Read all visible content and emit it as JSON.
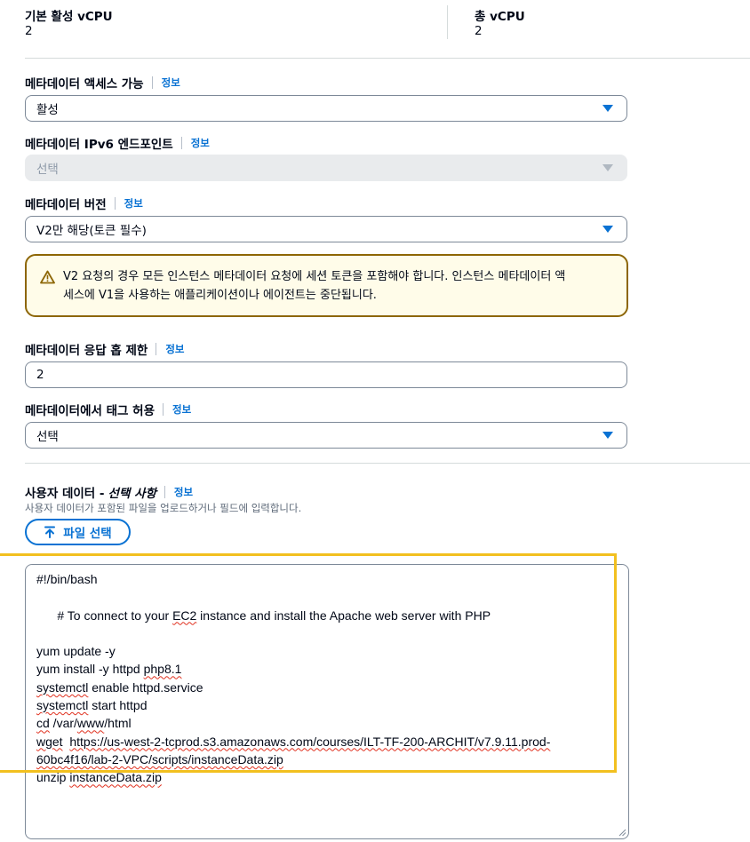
{
  "stats": {
    "default_vcpu_label": "기본 활성 vCPU",
    "default_vcpu_value": "2",
    "total_vcpu_label": "총 vCPU",
    "total_vcpu_value": "2"
  },
  "metadata_access": {
    "label": "메타데이터 액세스 가능",
    "info": "정보",
    "value": "활성"
  },
  "metadata_ipv6": {
    "label": "메타데이터 IPv6 엔드포인트",
    "info": "정보",
    "value": "선택"
  },
  "metadata_version": {
    "label": "메타데이터 버전",
    "info": "정보",
    "value": "V2만 해당(토큰 필수)"
  },
  "alert": {
    "icon": "warning-icon",
    "line1": "V2 요청의 경우 모든 인스턴스 메타데이터 요청에 세션 토큰을 포함해야 합니다. 인스턴스 메타데이터 액",
    "line2": "세스에 V1을 사용하는 애플리케이션이나 에이전트는 중단됩니다."
  },
  "hop_limit": {
    "label": "메타데이터 응답 홉 제한",
    "info": "정보",
    "value": "2"
  },
  "metadata_tags": {
    "label": "메타데이터에서 태그 허용",
    "info": "정보",
    "value": "선택"
  },
  "user_data": {
    "label": "사용자 데이터 - ",
    "label_optional": "선택 사항",
    "info": "정보",
    "description": "사용자 데이터가 포함된 파일을 업로드하거나 필드에 입력합니다.",
    "upload_button": "파일 선택",
    "script_lines": [
      "#!/bin/bash",
      "# To connect to your EC2 instance and install the Apache web server with PHP",
      "yum update -y",
      "yum install -y httpd php8.1",
      "systemctl enable httpd.service",
      "systemctl start httpd",
      "cd /var/www/html",
      "wget  https://us-west-2-tcprod.s3.amazonaws.com/courses/ILT-TF-200-ARCHIT/v7.9.11.prod-",
      "60bc4f16/lab-2-VPC/scripts/instanceData.zip",
      "unzip instanceData.zip"
    ]
  },
  "colors": {
    "link": "#0972d3",
    "warning_border": "#8d6605",
    "warning_bg": "#fffce9",
    "highlight": "#f2c01f",
    "spell_error": "#e0301e"
  }
}
